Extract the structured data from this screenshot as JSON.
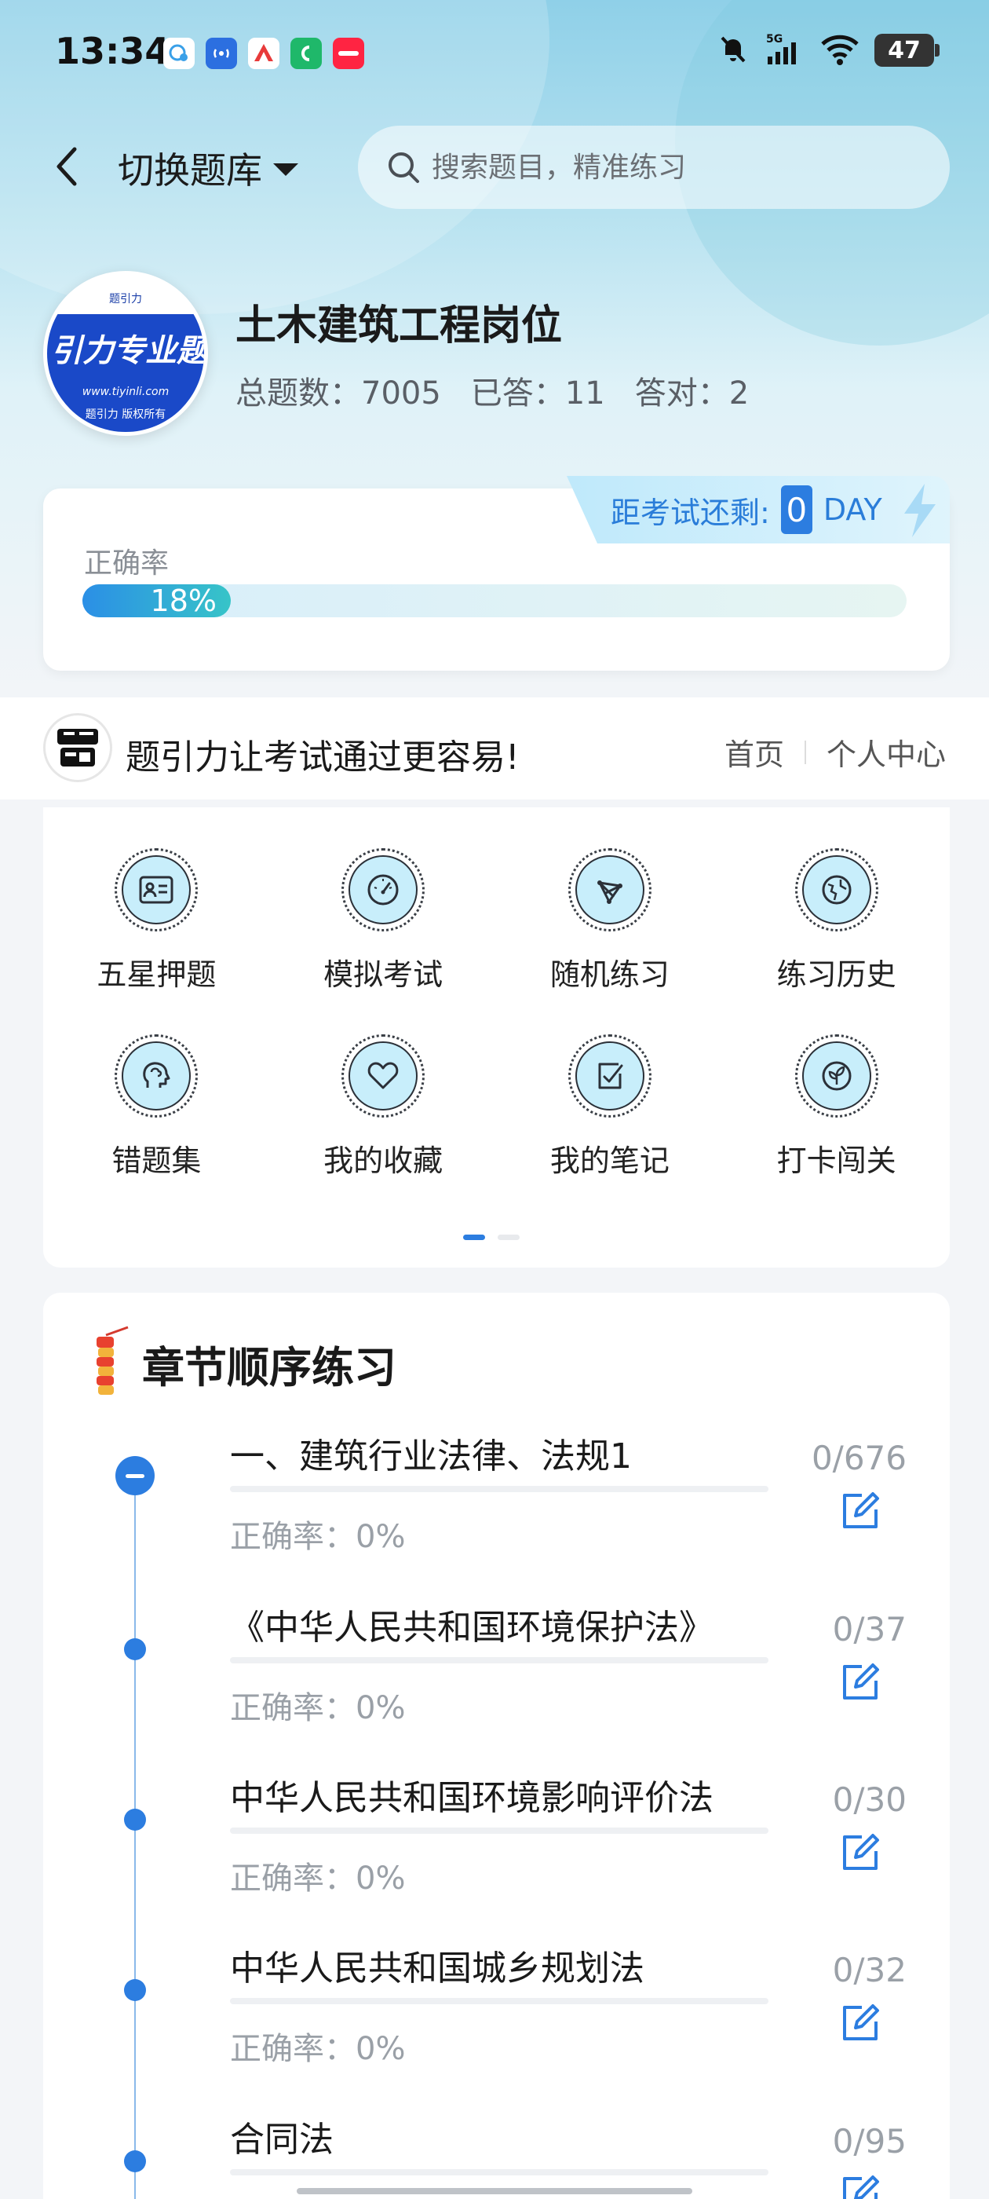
{
  "status_bar": {
    "time": "13:34",
    "network": "5G",
    "battery": "47"
  },
  "header": {
    "switch_label": "切换题库",
    "search_placeholder": "搜索题目，精准练习"
  },
  "profile": {
    "avatar_text_top": "题引力",
    "avatar_text_main": "引力专业题",
    "avatar_url": "www.tiyinli.com",
    "avatar_footer": "题引力 版权所有",
    "title": "土木建筑工程岗位",
    "stats": [
      {
        "label": "总题数：",
        "value": "7005"
      },
      {
        "label": "已答：",
        "value": "11"
      },
      {
        "label": "答对：",
        "value": "2"
      }
    ]
  },
  "accuracy": {
    "countdown_label": "距考试还剩:",
    "countdown_value": "0",
    "countdown_unit": "DAY",
    "label": "正确率",
    "percent_text": "18%",
    "percent": 18
  },
  "promo": {
    "text": "题引力让考试通过更容易!",
    "links": [
      "首页",
      "个人中心"
    ]
  },
  "features": [
    {
      "label": "五星押题",
      "icon": "id-card-icon"
    },
    {
      "label": "模拟考试",
      "icon": "speedometer-icon"
    },
    {
      "label": "随机练习",
      "icon": "random-network-icon"
    },
    {
      "label": "练习历史",
      "icon": "globe-history-icon"
    },
    {
      "label": "错题集",
      "icon": "brain-head-icon"
    },
    {
      "label": "我的收藏",
      "icon": "heart-icon"
    },
    {
      "label": "我的笔记",
      "icon": "note-check-icon"
    },
    {
      "label": "打卡闯关",
      "icon": "leaf-badge-icon"
    }
  ],
  "chapters": {
    "title": "章节顺序练习",
    "rate_label": "正确率：0%",
    "items": [
      {
        "name": "一、建筑行业法律、法规1",
        "count": "0/676",
        "rate": "正确率：0%"
      },
      {
        "name": "《中华人民共和国环境保护法》",
        "count": "0/37",
        "rate": "正确率：0%"
      },
      {
        "name": "中华人民共和国环境影响评价法",
        "count": "0/30",
        "rate": "正确率：0%"
      },
      {
        "name": "中华人民共和国城乡规划法",
        "count": "0/32",
        "rate": "正确率：0%"
      },
      {
        "name": "合同法",
        "count": "0/95",
        "rate": ""
      }
    ]
  },
  "colors": {
    "accent": "#2c7de0",
    "icon_fill": "#c8eefb"
  }
}
